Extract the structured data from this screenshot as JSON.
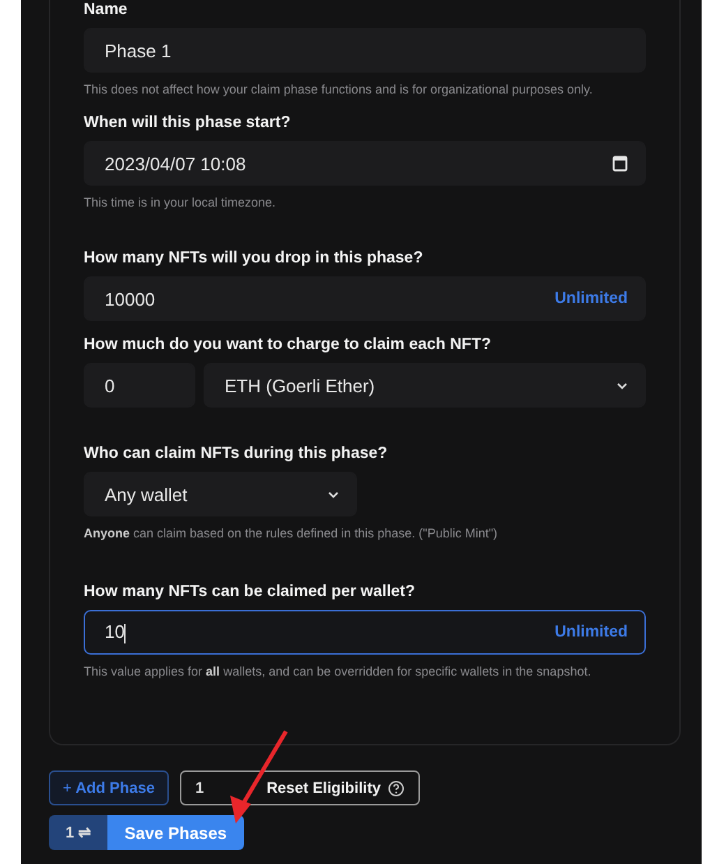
{
  "fields": [
    {
      "kind": "text",
      "label": "Name",
      "value": "Phase 1",
      "help": "This does not affect how your claim phase functions and is for organizational purposes only.",
      "focused": false
    },
    {
      "kind": "date",
      "label": "When will this phase start?",
      "value": "2023/04/07 10:08",
      "help": "This time is in your local timezone.",
      "focused": false
    },
    {
      "kind": "amount",
      "label": "How many NFTs will you drop in this phase?",
      "value": "10000",
      "action": "Unlimited",
      "focused": false
    },
    {
      "kind": "price",
      "label": "How much do you want to charge to claim each NFT?",
      "value": "0",
      "currency": "ETH (Goerli Ether)",
      "focused": false
    },
    {
      "kind": "select",
      "label": "Who can claim NFTs during this phase?",
      "value": "Any wallet",
      "help": "**Anyone** can claim based on the rules defined in this phase. (\"Public Mint\")",
      "focused": false
    },
    {
      "kind": "amount",
      "label": "How many NFTs can be claimed per wallet?",
      "value": "10",
      "action": "Unlimited",
      "help": "This value applies for **all** wallets, and can be overridden for specific wallets in the snapshot.",
      "focused": true
    }
  ],
  "add_button": {
    "icon": "+",
    "label": "Add Phase"
  },
  "reset_button": {
    "badge": "1",
    "label": "Reset Eligibility"
  },
  "save_button": {
    "count": "1 ⇌",
    "label": "Save Phases"
  }
}
